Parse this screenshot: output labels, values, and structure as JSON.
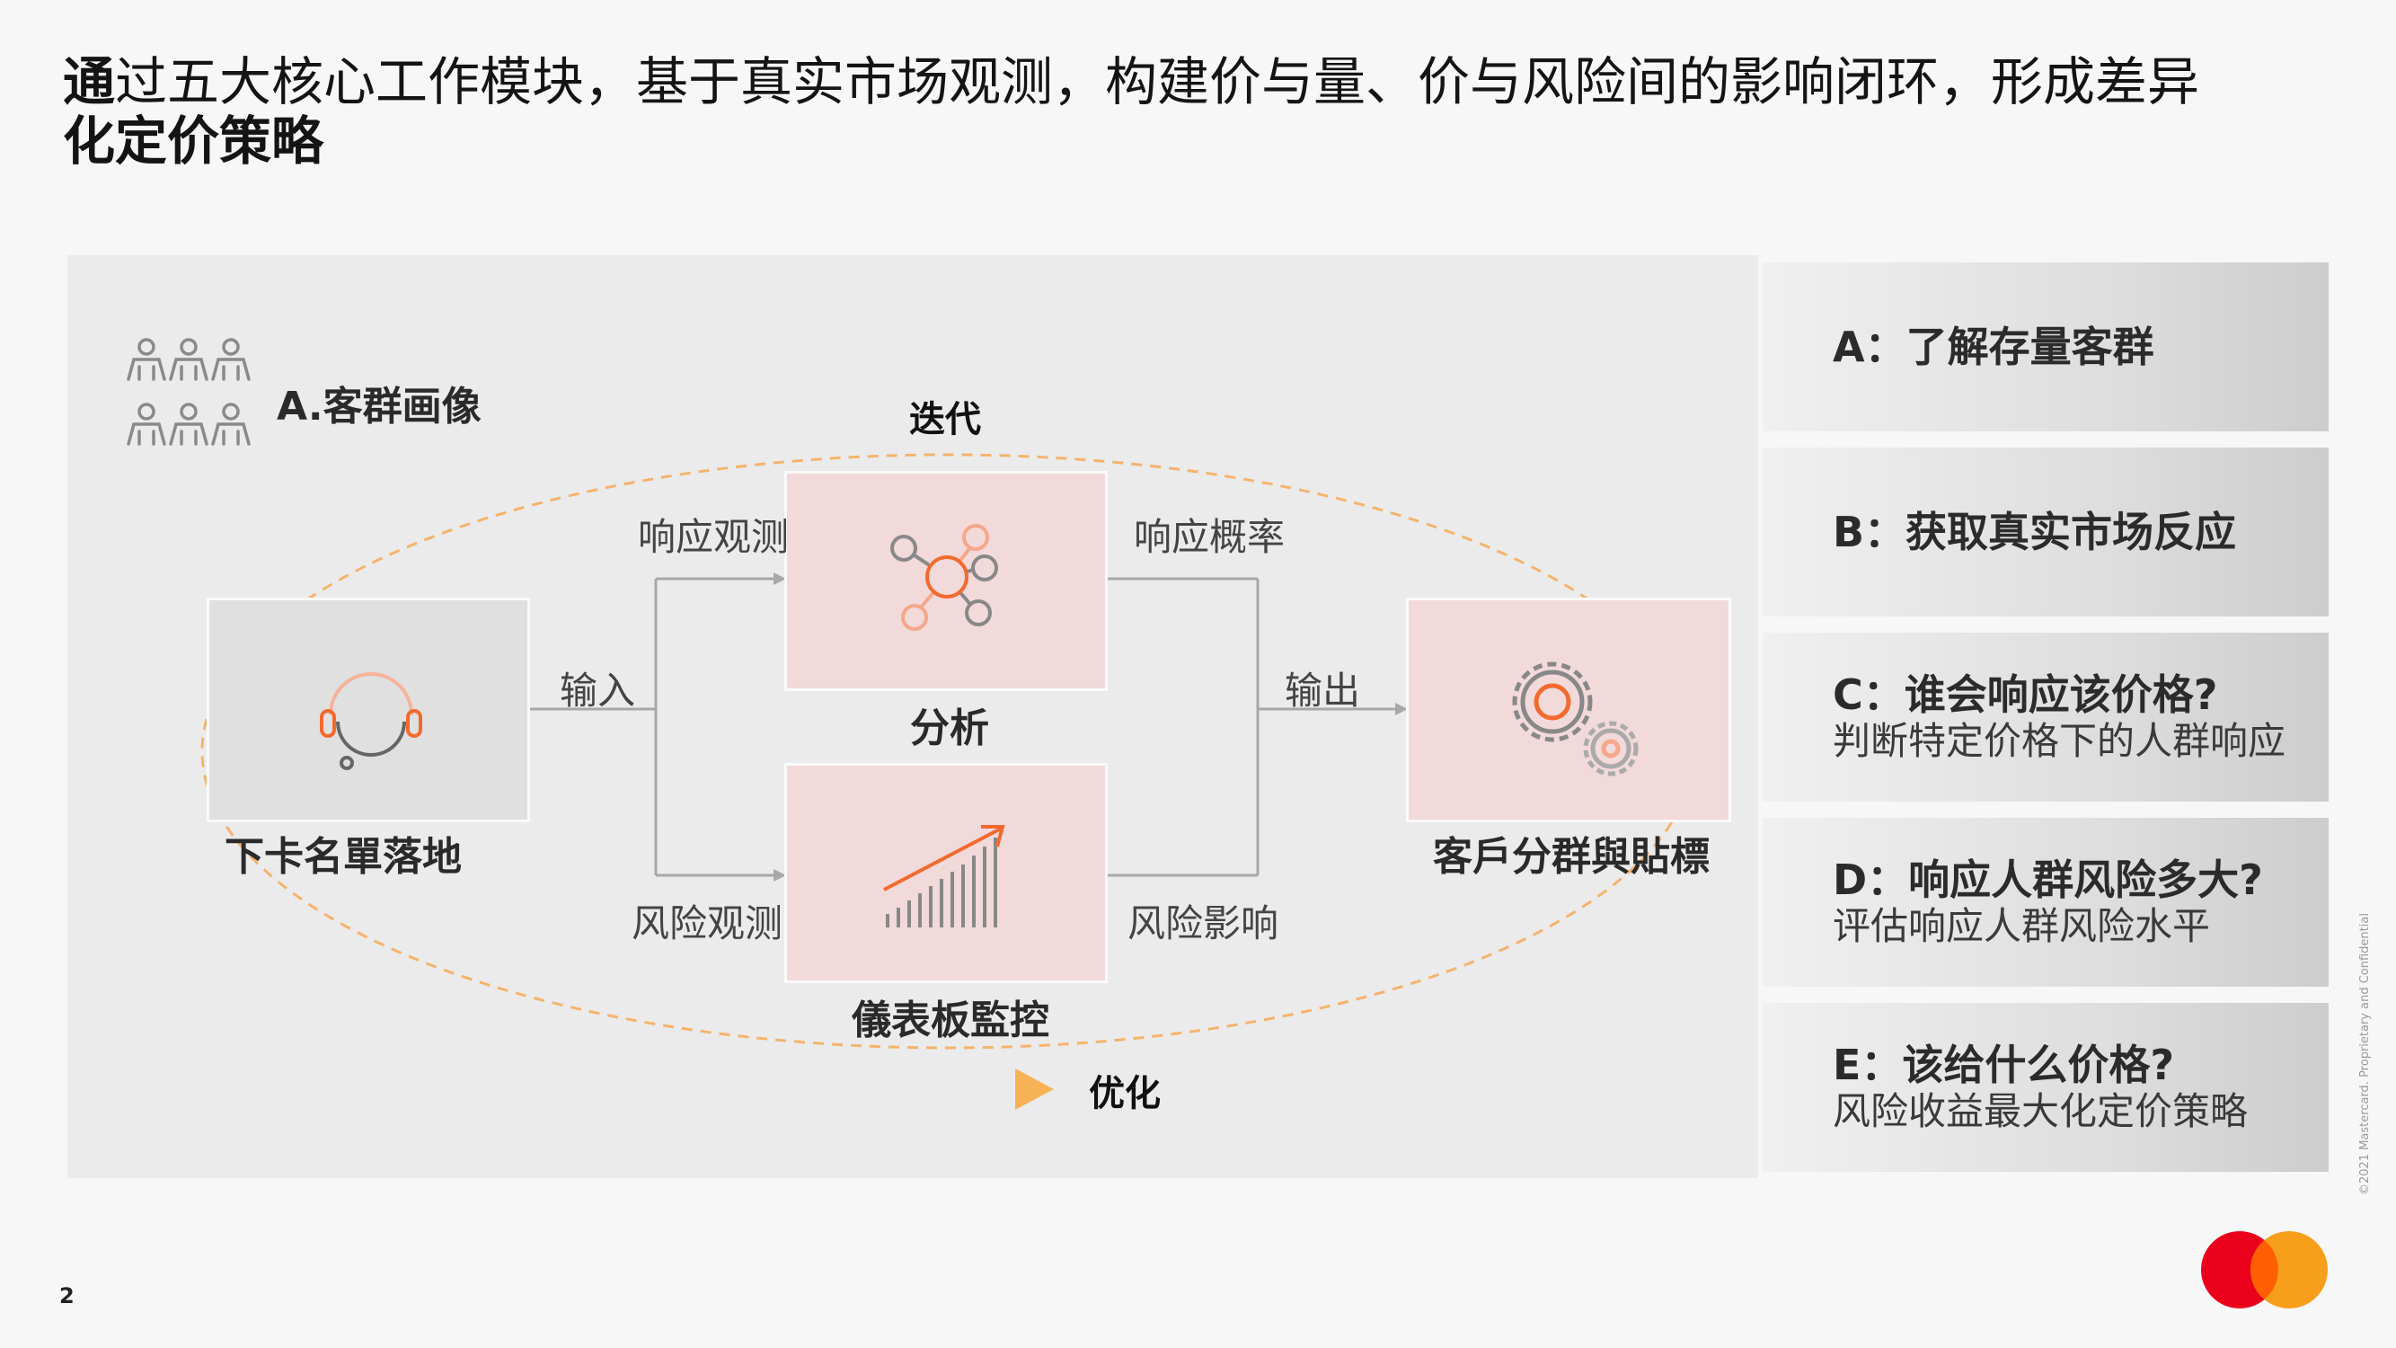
{
  "title": {
    "first_char": "通",
    "rest": "过五大核心工作模块，基于真实市场观测，构建价与量、价与风险间的影响闭环，形成差异",
    "line2": "化定价策略"
  },
  "diagram": {
    "segment_label": "A.客群画像",
    "loop_top_label": "迭代",
    "loop_bottom_label": "优化",
    "input_box_label": "下卡名單落地",
    "analysis_label": "分析",
    "dashboard_label": "儀表板監控",
    "output_box_label": "客戶分群與貼標",
    "edge_input": "输入",
    "edge_response_observe": "响应观测",
    "edge_risk_observe": "风险观测",
    "edge_response_prob": "响应概率",
    "edge_risk_impact": "风险影响",
    "edge_output": "输出",
    "icons": [
      "people-group-icon",
      "headset-icon",
      "network-nodes-icon",
      "growth-chart-icon",
      "gears-icon"
    ]
  },
  "cards": [
    {
      "heading": "A：了解存量客群",
      "sub": ""
    },
    {
      "heading": "B：获取真实市场反应",
      "sub": ""
    },
    {
      "heading": "C：谁会响应该价格?",
      "sub": "判断特定价格下的人群响应"
    },
    {
      "heading": "D：响应人群风险多大?",
      "sub": "评估响应人群风险水平"
    },
    {
      "heading": "E：该给什么价格?",
      "sub": "风险收益最大化定价策略"
    }
  ],
  "footer": {
    "page_number": "2",
    "confidential": "©2021 Mastercard. Proprietary and Confidential"
  },
  "colors": {
    "accent_orange": "#f26a2e",
    "loop_orange": "#f5a623",
    "mc_red": "#eb001b",
    "mc_yellow": "#f79e1b",
    "box_pink": "#f2d9da"
  }
}
